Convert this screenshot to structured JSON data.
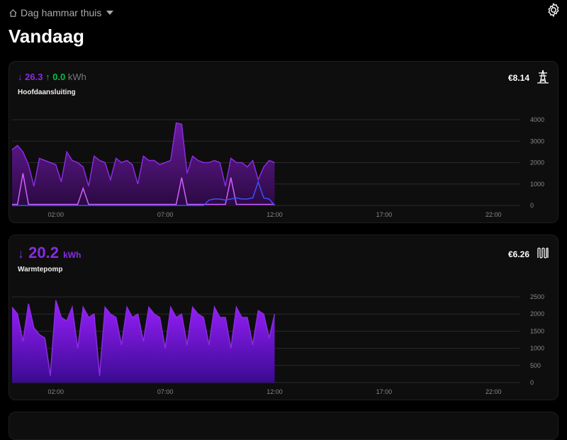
{
  "header": {
    "home_name": "Dag hammar thuis",
    "title": "Vandaag"
  },
  "colors": {
    "import": "#8a2be2",
    "export": "#00c040",
    "spike": "#d060ff",
    "blue": "#3a50ff"
  },
  "cards": [
    {
      "import_value": "26.3",
      "export_value": "0.0",
      "unit": "kWh",
      "name": "Hoofdaansluiting",
      "cost": "€8.14",
      "icon": "power-pylon-icon"
    },
    {
      "import_value": "20.2",
      "unit": "kWh",
      "name": "Warmtepomp",
      "cost": "€6.26",
      "icon": "radiator-icon"
    }
  ],
  "chart_data": [
    {
      "type": "area",
      "x_ticks": [
        "02:00",
        "07:00",
        "12:00",
        "17:00",
        "22:00"
      ],
      "x_range_hours": [
        0,
        24
      ],
      "interval_minutes": 15,
      "y_ticks": [
        "0",
        "1000",
        "2000",
        "3000",
        "4000"
      ],
      "ylim": [
        0,
        4000
      ],
      "series": [
        {
          "name": "import",
          "values": [
            2600,
            2800,
            2500,
            1900,
            900,
            2200,
            2100,
            2000,
            1900,
            1100,
            2500,
            2100,
            2000,
            1800,
            900,
            2300,
            2100,
            2000,
            1200,
            2200,
            2000,
            2100,
            1900,
            1000,
            2300,
            2100,
            2100,
            1900,
            2000,
            2100,
            3850,
            3800,
            1500,
            2300,
            2100,
            2000,
            2000,
            2100,
            2000,
            900,
            2200,
            2000,
            2000,
            1800,
            2100,
            1200,
            1800,
            2100,
            2000
          ]
        },
        {
          "name": "spike",
          "values": [
            50,
            50,
            1500,
            50,
            50,
            50,
            50,
            50,
            50,
            50,
            50,
            50,
            50,
            800,
            50,
            50,
            50,
            50,
            50,
            50,
            50,
            50,
            50,
            50,
            50,
            50,
            50,
            50,
            50,
            50,
            50,
            1300,
            50,
            50,
            50,
            50,
            50,
            50,
            50,
            50,
            1300,
            50,
            50,
            50,
            50,
            50,
            50,
            50,
            50
          ]
        },
        {
          "name": "blue",
          "values": [
            0,
            0,
            0,
            0,
            0,
            0,
            0,
            0,
            0,
            0,
            0,
            0,
            0,
            0,
            0,
            0,
            0,
            0,
            0,
            0,
            0,
            0,
            0,
            0,
            0,
            0,
            0,
            0,
            0,
            0,
            0,
            0,
            0,
            0,
            0,
            0,
            250,
            300,
            300,
            250,
            300,
            350,
            300,
            300,
            350,
            1100,
            350,
            300,
            0
          ]
        }
      ]
    },
    {
      "type": "area",
      "x_ticks": [
        "02:00",
        "07:00",
        "12:00",
        "17:00",
        "22:00"
      ],
      "x_range_hours": [
        0,
        24
      ],
      "interval_minutes": 15,
      "y_ticks": [
        "0",
        "500",
        "1000",
        "1500",
        "2000",
        "2500"
      ],
      "ylim": [
        0,
        2500
      ],
      "series": [
        {
          "name": "import",
          "values": [
            2200,
            2000,
            1200,
            2300,
            1600,
            1400,
            1300,
            200,
            2400,
            1900,
            1800,
            2200,
            1000,
            2200,
            1900,
            2000,
            200,
            2200,
            2000,
            1900,
            1100,
            2200,
            1900,
            2000,
            1200,
            2200,
            2000,
            1900,
            1000,
            2200,
            1900,
            2000,
            1100,
            2200,
            2000,
            1900,
            1100,
            2200,
            1900,
            1900,
            1000,
            2200,
            1900,
            1900,
            1100,
            2100,
            2000,
            1300,
            2000
          ]
        }
      ]
    }
  ]
}
